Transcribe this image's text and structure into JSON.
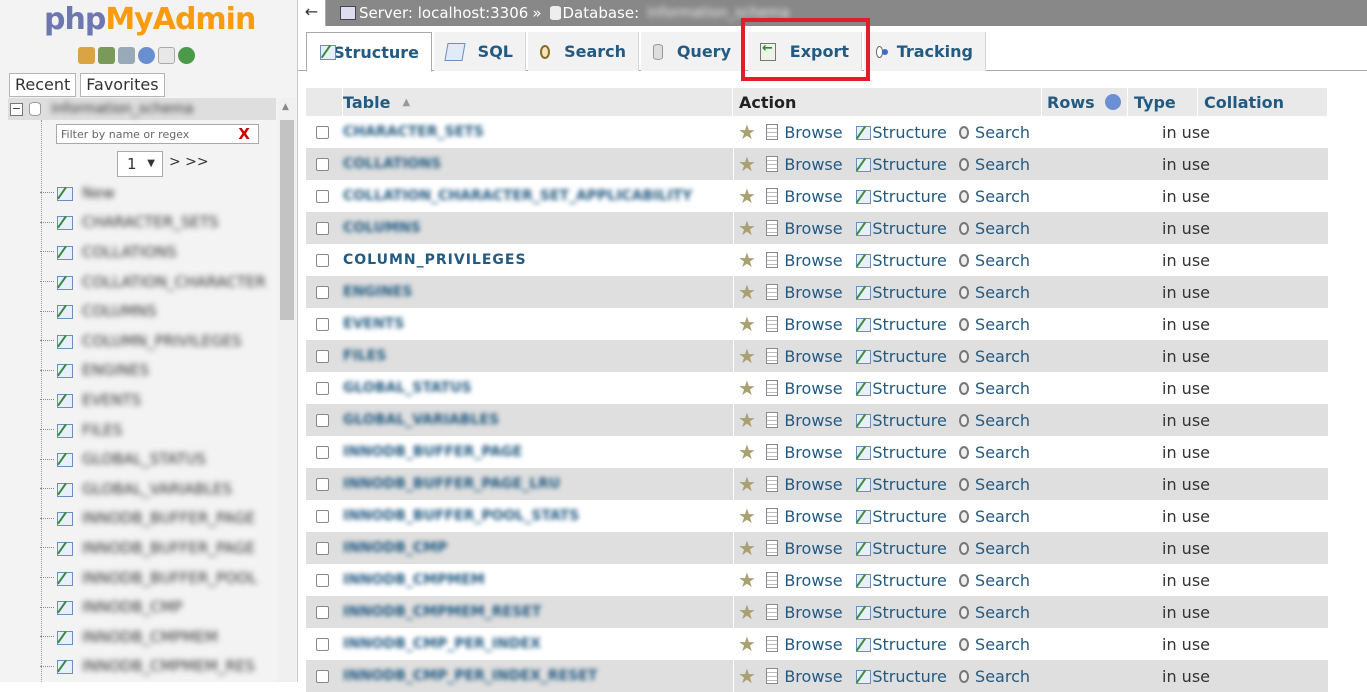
{
  "app": {
    "logo_php": "php",
    "logo_myadmin": "MyAdmin"
  },
  "nav": {
    "tabs": [
      "Recent",
      "Favorites"
    ],
    "db_name": "information_schema",
    "filter_placeholder": "Filter by name or regex",
    "filter_clear": "X",
    "page": "1",
    "page_next": "> >>",
    "new_label": "New",
    "tables": [
      "CHARACTER_SETS",
      "COLLATIONS",
      "COLLATION_CHARACTER",
      "COLUMNS",
      "COLUMN_PRIVILEGES",
      "ENGINES",
      "EVENTS",
      "FILES",
      "GLOBAL_STATUS",
      "GLOBAL_VARIABLES",
      "INNODB_BUFFER_PAGE",
      "INNODB_BUFFER_PAGE",
      "INNODB_BUFFER_POOL",
      "INNODB_CMP",
      "INNODB_CMPMEM",
      "INNODB_CMPMEM_RES"
    ]
  },
  "breadcrumb": {
    "server_label": "Server: localhost:3306",
    "separator": "»",
    "database_label": "Database:",
    "database_name": "information_schema"
  },
  "tabs": [
    {
      "label": "Structure",
      "icon": "structure-icon",
      "active": true
    },
    {
      "label": "SQL",
      "icon": "sql-icon",
      "active": false
    },
    {
      "label": "Search",
      "icon": "search-icon",
      "active": false
    },
    {
      "label": "Query",
      "icon": "query-icon",
      "active": false
    },
    {
      "label": "Export",
      "icon": "export-icon",
      "active": false,
      "highlighted": true
    },
    {
      "label": "Tracking",
      "icon": "tracking-icon",
      "active": false
    }
  ],
  "highlight_color": "#e01e2b",
  "table": {
    "headers": {
      "table": "Table",
      "sort_indicator": "▲",
      "action": "Action",
      "rows": "Rows",
      "type": "Type",
      "collation": "Collation"
    },
    "action_labels": {
      "browse": "Browse",
      "structure": "Structure",
      "search": "Search"
    },
    "rows": [
      {
        "name": "CHARACTER_SETS",
        "status": "in use"
      },
      {
        "name": "COLLATIONS",
        "status": "in use"
      },
      {
        "name": "COLLATION_CHARACTER_SET_APPLICABILITY",
        "status": "in use"
      },
      {
        "name": "COLUMNS",
        "status": "in use"
      },
      {
        "name": "COLUMN_PRIVILEGES",
        "status": "in use"
      },
      {
        "name": "ENGINES",
        "status": "in use"
      },
      {
        "name": "EVENTS",
        "status": "in use"
      },
      {
        "name": "FILES",
        "status": "in use"
      },
      {
        "name": "GLOBAL_STATUS",
        "status": "in use"
      },
      {
        "name": "GLOBAL_VARIABLES",
        "status": "in use"
      },
      {
        "name": "INNODB_BUFFER_PAGE",
        "status": "in use"
      },
      {
        "name": "INNODB_BUFFER_PAGE_LRU",
        "status": "in use"
      },
      {
        "name": "INNODB_BUFFER_POOL_STATS",
        "status": "in use"
      },
      {
        "name": "INNODB_CMP",
        "status": "in use"
      },
      {
        "name": "INNODB_CMPMEM",
        "status": "in use"
      },
      {
        "name": "INNODB_CMPMEM_RESET",
        "status": "in use"
      },
      {
        "name": "INNODB_CMP_PER_INDEX",
        "status": "in use"
      },
      {
        "name": "INNODB_CMP_PER_INDEX_RESET",
        "status": "in use"
      }
    ]
  }
}
